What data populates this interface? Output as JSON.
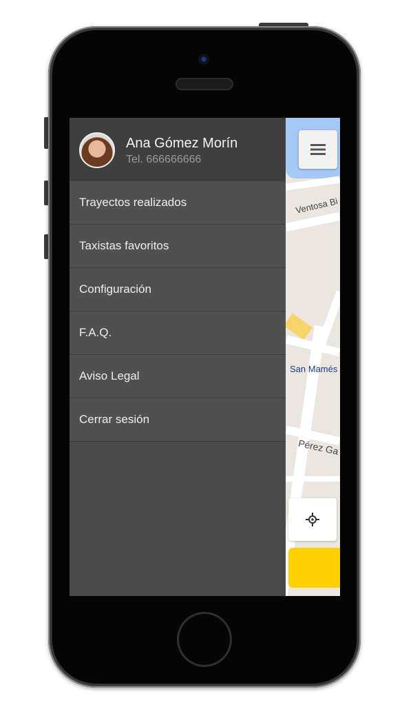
{
  "user": {
    "name": "Ana Gómez Morín",
    "phone": "Tel. 666666666"
  },
  "menu": {
    "items": [
      {
        "label": "Trayectos realizados"
      },
      {
        "label": "Taxistas favoritos"
      },
      {
        "label": "Configuración"
      },
      {
        "label": "F.A.Q."
      },
      {
        "label": "Aviso Legal"
      },
      {
        "label": "Cerrar sesión"
      }
    ]
  },
  "map": {
    "labels": {
      "street_1": "Ventosa Bi",
      "place": "San Mamés",
      "street_2": "Pérez Ga"
    }
  },
  "icons": {
    "menu": "hamburger-menu-icon",
    "locate": "crosshair-locate-icon"
  },
  "colors": {
    "drawer_bg": "#4a4a4a",
    "header_bg": "#3f3f3f",
    "accent_yellow": "#ffcf00",
    "water": "#a6c8f5"
  }
}
